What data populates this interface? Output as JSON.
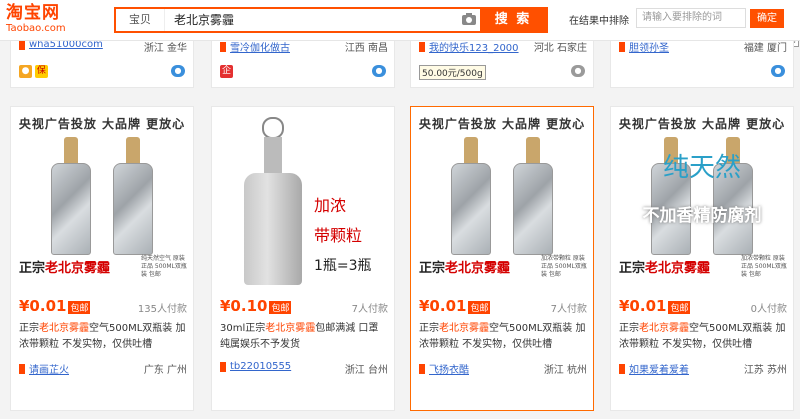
{
  "header": {
    "logo_main": "淘宝网",
    "logo_sub": "Taobao.com",
    "category": "宝贝",
    "query": "老北京雾霾",
    "search_label": "搜 索",
    "within_label": "在结果中排除",
    "within_placeholder": "请输入要排除的词",
    "confirm_label": "确定"
  },
  "top_cards": [
    {
      "shop": "wha51000com",
      "location": "浙江 金华"
    },
    {
      "shop": "雪冷伽化做古",
      "location": "江西 南昌"
    },
    {
      "shop": "我的快乐123_2000",
      "location": "河北 石家庄",
      "price_badge": "50.00元/500g"
    },
    {
      "shop": "胆领孙圣",
      "location": "福建 厦门"
    }
  ],
  "products": [
    {
      "header": "央视广告投放 大品牌 更放心",
      "tagline_prefix": "正宗",
      "tagline_red": "老北京雾霾",
      "note": "纯天然空气 原装正品 500ML双瓶装 包邮",
      "price": "¥0.01",
      "badge": "包邮",
      "sold": "135人付款",
      "title_pre": "正宗",
      "title_kw": "老北京雾霾",
      "title_post": "空气500ML双瓶装 加浓带颗粒 不发实物，仅供吐槽",
      "shop": "请画芷火",
      "location": "广东 广州"
    },
    {
      "red1": "加浓",
      "red2": "带颗粒",
      "black": "1瓶=3瓶",
      "price": "¥0.10",
      "badge": "包邮",
      "sold": "7人付款",
      "title_pre": "30ml正宗",
      "title_kw": "老北京雾霾",
      "title_post": "包邮满減 口罩纯属娱乐不予发货",
      "shop": "tb22010555",
      "location": "浙江 台州"
    },
    {
      "header": "央视广告投放 大品牌 更放心",
      "tagline_prefix": "正宗",
      "tagline_red": "老北京雾霾",
      "note": "加浓带颗粒 原装正品 500ML双瓶装 包邮",
      "price": "¥0.01",
      "badge": "包邮",
      "sold": "7人付款",
      "title_pre": "正宗",
      "title_kw": "老北京雾霾",
      "title_post": "空气500ML双瓶装 加浓带颗粒 不发实物，仅供吐槽",
      "shop": "飞扬衣酷",
      "location": "浙江 杭州"
    },
    {
      "header": "央视广告投放 大品牌 更放心",
      "overlay_blue": "纯天然",
      "overlay_white": "不加香精防腐剂",
      "tagline_prefix": "正宗",
      "tagline_red": "老北京雾霾",
      "note": "加浓带颗粒 原装正品 500ML双瓶装 包邮",
      "price": "¥0.01",
      "badge": "包邮",
      "sold": "0人付款",
      "title_pre": "正宗",
      "title_kw": "老北京雾霾",
      "title_post": "空气500ML双瓶装 加浓带颗粒 不发实物，仅供吐槽",
      "shop": "如果爱着爱着",
      "location": "江苏 苏州"
    }
  ]
}
